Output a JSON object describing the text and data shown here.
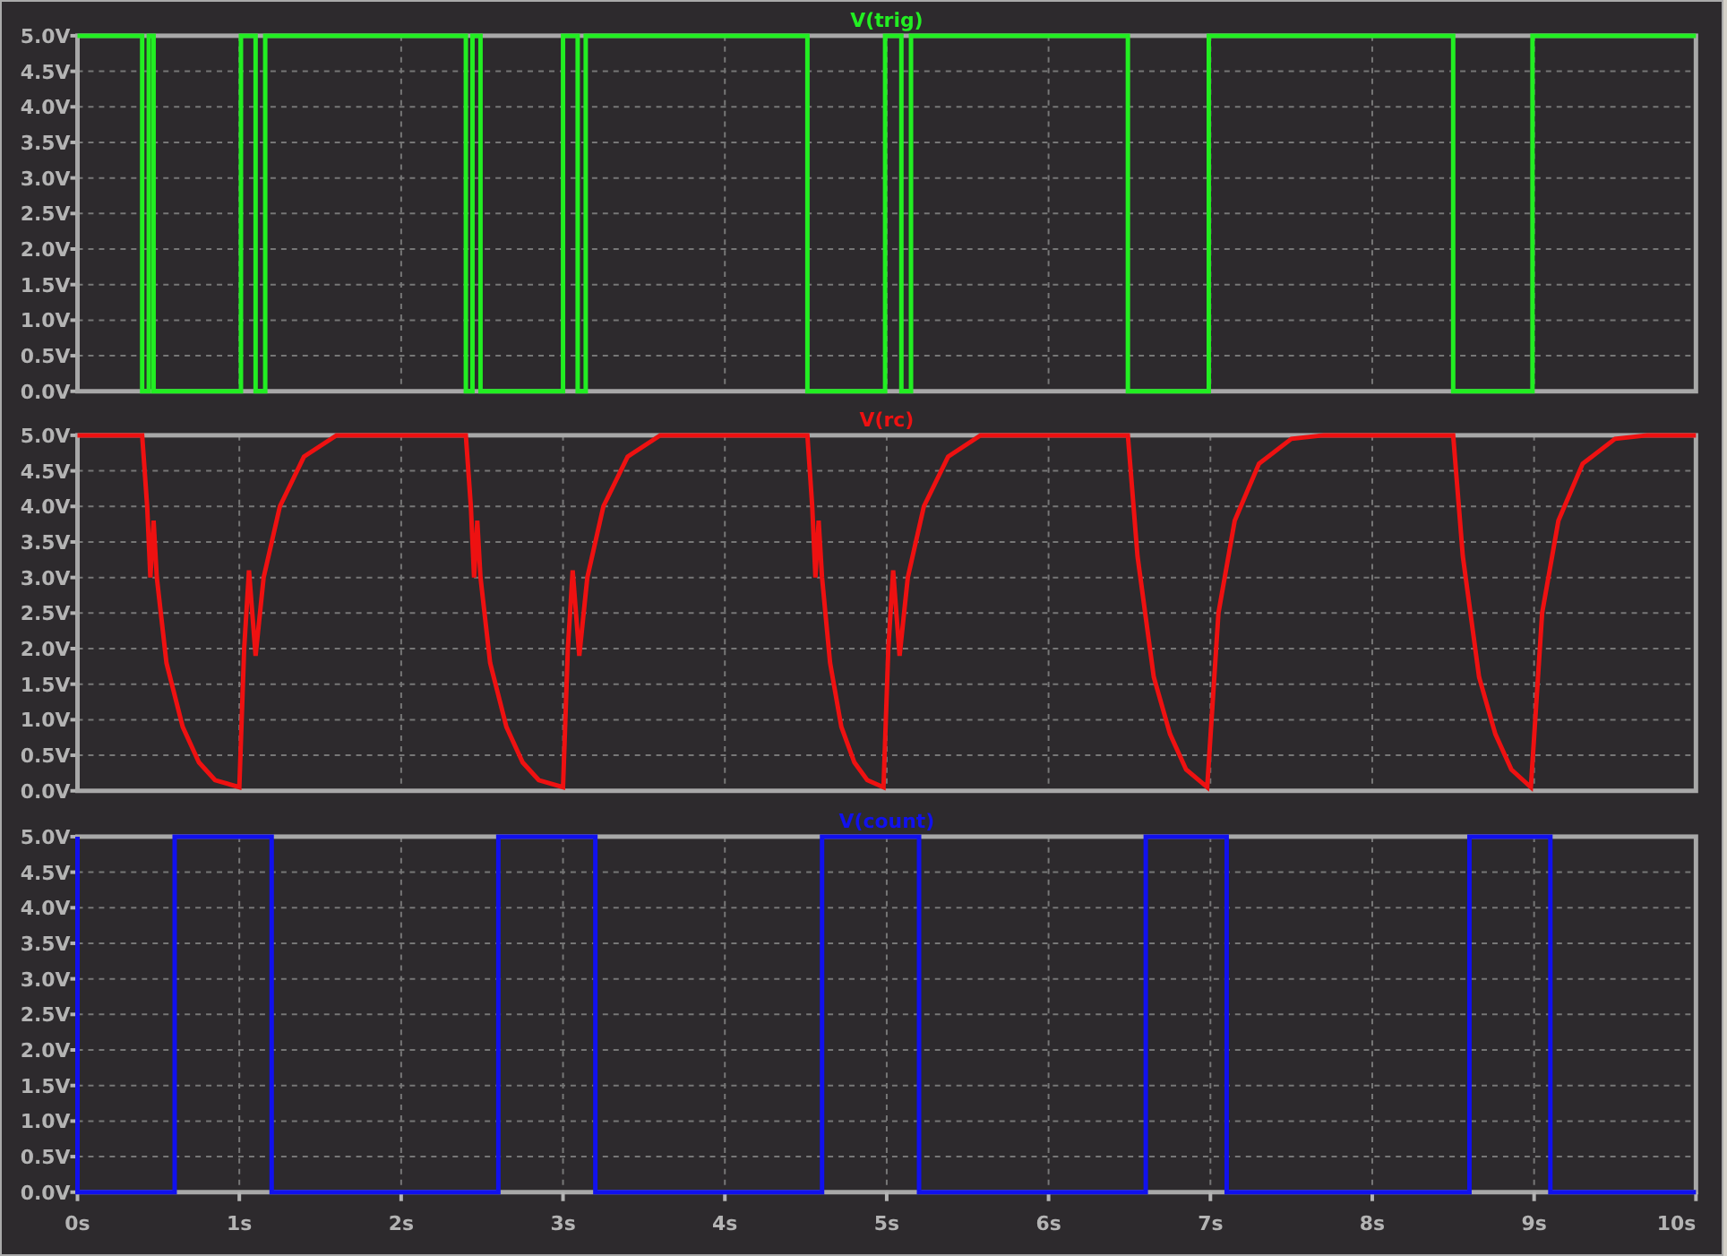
{
  "panes": [
    {
      "chart_data": {
        "type": "line",
        "grid": true,
        "xlim": [
          0,
          10
        ],
        "ylim": [
          0,
          5
        ],
        "yticks": [
          {
            "value": 5,
            "label": "5.0V"
          },
          {
            "value": 4.5,
            "label": "4.5V"
          },
          {
            "value": 4,
            "label": "4.0V"
          },
          {
            "value": 3.5,
            "label": "3.5V"
          },
          {
            "value": 3,
            "label": "3.0V"
          },
          {
            "value": 2.5,
            "label": "2.5V"
          },
          {
            "value": 2,
            "label": "2.0V"
          },
          {
            "value": 1.5,
            "label": "1.5V"
          },
          {
            "value": 1,
            "label": "1.0V"
          },
          {
            "value": 0.5,
            "label": "0.5V"
          },
          {
            "value": 0,
            "label": "0.0V"
          }
        ],
        "x": [
          0,
          0.4,
          0.4,
          0.44,
          0.44,
          0.47,
          0.47,
          1.01,
          1.01,
          1.1,
          1.1,
          1.16,
          1.16,
          2.4,
          2.4,
          2.44,
          2.44,
          2.49,
          2.49,
          3.0,
          3.0,
          3.09,
          3.09,
          3.14,
          3.14,
          4.51,
          4.51,
          4.99,
          4.99,
          5.09,
          5.09,
          5.15,
          5.15,
          6.49,
          6.49,
          6.99,
          6.99,
          8.5,
          8.5,
          8.99,
          8.99,
          10
        ],
        "series": [
          {
            "name": "V(trig)",
            "color": "#22ee22",
            "values": [
              5,
              5,
              0,
              0,
              5,
              5,
              0,
              0,
              5,
              5,
              0,
              0,
              5,
              5,
              0,
              0,
              5,
              5,
              0,
              0,
              5,
              5,
              0,
              0,
              5,
              5,
              0,
              0,
              5,
              5,
              0,
              0,
              5,
              5,
              0,
              0,
              5,
              5,
              0,
              0,
              5,
              5
            ]
          }
        ]
      }
    },
    {
      "chart_data": {
        "type": "line",
        "grid": true,
        "xlim": [
          0,
          10
        ],
        "ylim": [
          0,
          5
        ],
        "yticks": [
          {
            "value": 5,
            "label": "5.0V"
          },
          {
            "value": 4.5,
            "label": "4.5V"
          },
          {
            "value": 4,
            "label": "4.0V"
          },
          {
            "value": 3.5,
            "label": "3.5V"
          },
          {
            "value": 3,
            "label": "3.0V"
          },
          {
            "value": 2.5,
            "label": "2.5V"
          },
          {
            "value": 2,
            "label": "2.0V"
          },
          {
            "value": 1.5,
            "label": "1.5V"
          },
          {
            "value": 1,
            "label": "1.0V"
          },
          {
            "value": 0.5,
            "label": "0.5V"
          },
          {
            "value": 0,
            "label": "0.0V"
          }
        ],
        "x": [
          0,
          0.4,
          0.43,
          0.45,
          0.47,
          0.49,
          0.55,
          0.65,
          0.75,
          0.85,
          1.0,
          1.03,
          1.06,
          1.1,
          1.15,
          1.25,
          1.4,
          1.6,
          2.4,
          2.43,
          2.45,
          2.47,
          2.49,
          2.55,
          2.65,
          2.75,
          2.85,
          3.0,
          3.03,
          3.06,
          3.1,
          3.15,
          3.25,
          3.4,
          3.6,
          4.51,
          4.54,
          4.56,
          4.58,
          4.6,
          4.65,
          4.72,
          4.8,
          4.88,
          4.98,
          5.01,
          5.04,
          5.08,
          5.13,
          5.23,
          5.38,
          5.58,
          6.49,
          6.55,
          6.65,
          6.75,
          6.85,
          6.98,
          7.05,
          7.15,
          7.3,
          7.5,
          7.7,
          8.5,
          8.56,
          8.66,
          8.76,
          8.86,
          8.98,
          9.05,
          9.15,
          9.3,
          9.5,
          9.7,
          10
        ],
        "series": [
          {
            "name": "V(rc)",
            "color": "#ee1111",
            "values": [
              5,
              5,
              4.0,
              3.0,
              3.8,
              3.0,
              1.8,
              0.9,
              0.4,
              0.15,
              0.05,
              2.0,
              3.1,
              1.9,
              3.0,
              4.0,
              4.7,
              5.0,
              5,
              4.0,
              3.0,
              3.8,
              3.0,
              1.8,
              0.9,
              0.4,
              0.15,
              0.05,
              2.0,
              3.1,
              1.9,
              3.0,
              4.0,
              4.7,
              5.0,
              5,
              4.0,
              3.0,
              3.8,
              3.0,
              1.8,
              0.9,
              0.4,
              0.15,
              0.05,
              2.0,
              3.1,
              1.9,
              3.0,
              4.0,
              4.7,
              5.0,
              5,
              3.3,
              1.6,
              0.8,
              0.3,
              0.05,
              2.5,
              3.8,
              4.6,
              4.95,
              5.0,
              5,
              3.3,
              1.6,
              0.8,
              0.3,
              0.05,
              2.5,
              3.8,
              4.6,
              4.95,
              5.0,
              5
            ]
          }
        ]
      }
    },
    {
      "chart_data": {
        "type": "line",
        "grid": true,
        "xlim": [
          0,
          10
        ],
        "ylim": [
          0,
          5
        ],
        "xticks": [
          {
            "value": 0,
            "label": "0s"
          },
          {
            "value": 1,
            "label": "1s"
          },
          {
            "value": 2,
            "label": "2s"
          },
          {
            "value": 3,
            "label": "3s"
          },
          {
            "value": 4,
            "label": "4s"
          },
          {
            "value": 5,
            "label": "5s"
          },
          {
            "value": 6,
            "label": "6s"
          },
          {
            "value": 7,
            "label": "7s"
          },
          {
            "value": 8,
            "label": "8s"
          },
          {
            "value": 9,
            "label": "9s"
          },
          {
            "value": 10,
            "label": "10s"
          }
        ],
        "yticks": [
          {
            "value": 5,
            "label": "5.0V"
          },
          {
            "value": 4.5,
            "label": "4.5V"
          },
          {
            "value": 4,
            "label": "4.0V"
          },
          {
            "value": 3.5,
            "label": "3.5V"
          },
          {
            "value": 3,
            "label": "3.0V"
          },
          {
            "value": 2.5,
            "label": "2.5V"
          },
          {
            "value": 2,
            "label": "2.0V"
          },
          {
            "value": 1.5,
            "label": "1.5V"
          },
          {
            "value": 1,
            "label": "1.0V"
          },
          {
            "value": 0.5,
            "label": "0.5V"
          },
          {
            "value": 0,
            "label": "0.0V"
          }
        ],
        "x": [
          0,
          0,
          0.6,
          0.6,
          1.2,
          1.2,
          2.6,
          2.6,
          3.2,
          3.2,
          4.6,
          4.6,
          5.2,
          5.2,
          6.6,
          6.6,
          7.1,
          7.1,
          8.6,
          8.6,
          9.1,
          9.1,
          10
        ],
        "series": [
          {
            "name": "V(count)",
            "color": "#1111ee",
            "values": [
              5,
              0,
              0,
              5,
              5,
              0,
              0,
              5,
              5,
              0,
              0,
              5,
              5,
              0,
              0,
              5,
              5,
              0,
              0,
              5,
              5,
              0,
              0
            ]
          }
        ]
      }
    }
  ]
}
